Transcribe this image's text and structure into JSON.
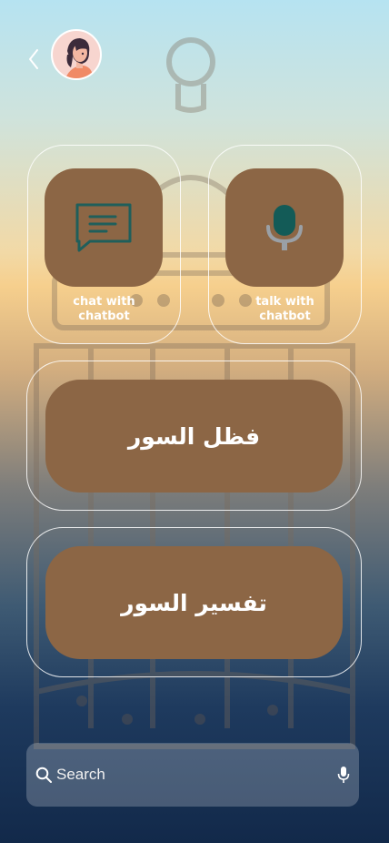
{
  "header": {
    "back_icon": "chevron-left-icon",
    "avatar_icon": "user-avatar-woman"
  },
  "tiles": {
    "chat": {
      "label_line1": "chat with",
      "label_line2": "chatbot",
      "icon": "chat-bubble-icon"
    },
    "talk": {
      "label_line1": "talk with",
      "label_line2": "chatbot",
      "icon": "microphone-icon"
    }
  },
  "buttons": {
    "surah_virtue": "فظل السور",
    "surah_tafsir": "تفسير السور"
  },
  "search": {
    "placeholder": "Search",
    "search_icon": "search-icon",
    "mic_icon": "microphone-icon"
  },
  "colors": {
    "tile_brown": "#8c6645",
    "icon_teal": "#1f5f5b",
    "card_border": "#ffffff"
  }
}
